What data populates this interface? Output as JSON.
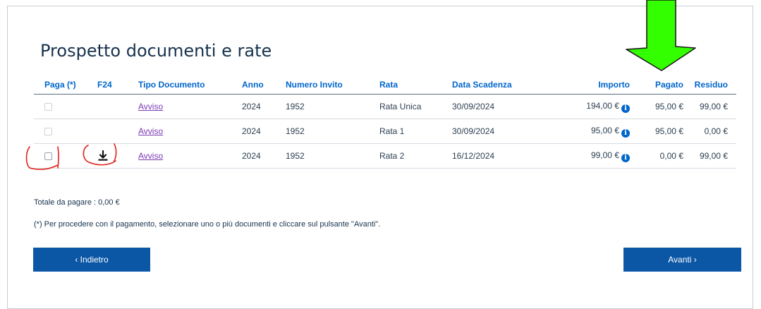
{
  "page_title": "Prospetto documenti e rate",
  "table": {
    "headers": [
      "Paga (*)",
      "F24",
      "Tipo Documento",
      "Anno",
      "Numero Invito",
      "Rata",
      "Data Scadenza",
      "Importo",
      "Pagato",
      "Residuo"
    ],
    "rows": [
      {
        "tipo": "Avviso",
        "anno": "2024",
        "numero": "1952",
        "rata": "Rata Unica",
        "scadenza": "30/09/2024",
        "importo": "194,00 €",
        "pagato": "95,00 €",
        "residuo": "99,00 €"
      },
      {
        "tipo": "Avviso",
        "anno": "2024",
        "numero": "1952",
        "rata": "Rata 1",
        "scadenza": "30/09/2024",
        "importo": "95,00 €",
        "pagato": "95,00 €",
        "residuo": "0,00 €"
      },
      {
        "tipo": "Avviso",
        "anno": "2024",
        "numero": "1952",
        "rata": "Rata 2",
        "scadenza": "16/12/2024",
        "importo": "99,00 €",
        "pagato": "0,00 €",
        "residuo": "99,00 €"
      }
    ],
    "info_glyph": "i"
  },
  "totale": "Totale da pagare : 0,00 €",
  "note": "(*) Per procedere con il pagamento, selezionare uno o più documenti e cliccare sul pulsante \"Avanti\".",
  "buttons": {
    "back": "‹ Indietro",
    "next": "Avanti ›"
  },
  "colors": {
    "primary": "#0b57a6",
    "link": "#7a3ab4",
    "annotation_red": "#e0201a",
    "arrow_green": "#33ff00"
  },
  "icons": {
    "download": "download-icon",
    "info": "info-icon"
  }
}
